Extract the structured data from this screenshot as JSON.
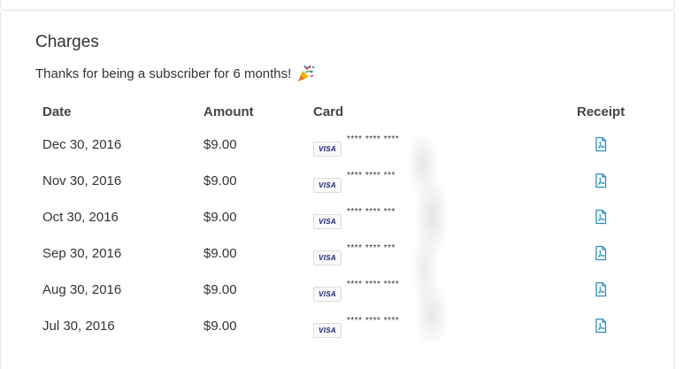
{
  "charges": {
    "title": "Charges",
    "subtitle": "Thanks for being a subscriber for 6 months!",
    "columns": {
      "date": "Date",
      "amount": "Amount",
      "card": "Card",
      "receipt": "Receipt"
    },
    "rows": [
      {
        "date": "Dec 30, 2016",
        "amount": "$9.00",
        "card_brand": "VISA",
        "card_mask": "**** **** ****"
      },
      {
        "date": "Nov 30, 2016",
        "amount": "$9.00",
        "card_brand": "VISA",
        "card_mask": "**** **** ***"
      },
      {
        "date": "Oct 30, 2016",
        "amount": "$9.00",
        "card_brand": "VISA",
        "card_mask": "**** **** ***"
      },
      {
        "date": "Sep 30, 2016",
        "amount": "$9.00",
        "card_brand": "VISA",
        "card_mask": "**** **** ***"
      },
      {
        "date": "Aug 30, 2016",
        "amount": "$9.00",
        "card_brand": "VISA",
        "card_mask": "**** **** ****"
      },
      {
        "date": "Jul 30, 2016",
        "amount": "$9.00",
        "card_brand": "VISA",
        "card_mask": "**** **** ****"
      }
    ]
  },
  "icons": {
    "celebration": "party-popper-icon",
    "receipt": "pdf-file-icon",
    "card": "visa-card-icon"
  },
  "colors": {
    "text": "#333333",
    "header_text": "#444444",
    "receipt_icon": "#2a8fbd",
    "visa_blue": "#1a1f71",
    "border": "#e3e3e3"
  }
}
